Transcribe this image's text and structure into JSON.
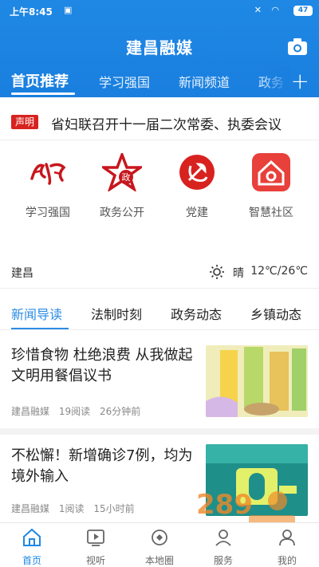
{
  "status_bar": {
    "time": "上午8:45",
    "battery": "47"
  },
  "header": {
    "app_title": "建昌融媒"
  },
  "tabs": [
    {
      "label": "首页推荐"
    },
    {
      "label": "学习强国"
    },
    {
      "label": "新闻频道"
    },
    {
      "label": "政务"
    }
  ],
  "notice": {
    "badge": "声明",
    "text": "省妇联召开十一届二次常委、执委会议"
  },
  "quick_links": [
    {
      "label": "学习强国",
      "icon": "xuexi-logo-icon"
    },
    {
      "label": "政务公开",
      "icon": "star-gov-icon"
    },
    {
      "label": "党建",
      "icon": "party-emblem-icon"
    },
    {
      "label": "智慧社区",
      "icon": "smart-community-icon"
    }
  ],
  "weather": {
    "city": "建昌",
    "condition": "晴",
    "temperature": "12℃/26℃"
  },
  "sub_tabs": [
    {
      "label": "新闻导读"
    },
    {
      "label": "法制时刻"
    },
    {
      "label": "政务动态"
    },
    {
      "label": "乡镇动态"
    }
  ],
  "articles": [
    {
      "title": "珍惜食物 杜绝浪费 从我做起 文明用餐倡议书",
      "source": "建昌融媒",
      "reads": "19阅读",
      "time": "26分钟前"
    },
    {
      "title": "不松懈！新增确诊7例，均为境外输入",
      "source": "建昌融媒",
      "reads": "1阅读",
      "time": "15小时前"
    }
  ],
  "bottom_nav": [
    {
      "label": "首页",
      "icon": "home-icon"
    },
    {
      "label": "视听",
      "icon": "video-icon"
    },
    {
      "label": "本地圈",
      "icon": "local-circle-icon"
    },
    {
      "label": "服务",
      "icon": "service-icon"
    },
    {
      "label": "我的",
      "icon": "profile-icon"
    }
  ],
  "colors": {
    "brand_blue": "#1a7fdf",
    "badge_red": "#d8221f",
    "active_tab": "#2b8be6"
  }
}
